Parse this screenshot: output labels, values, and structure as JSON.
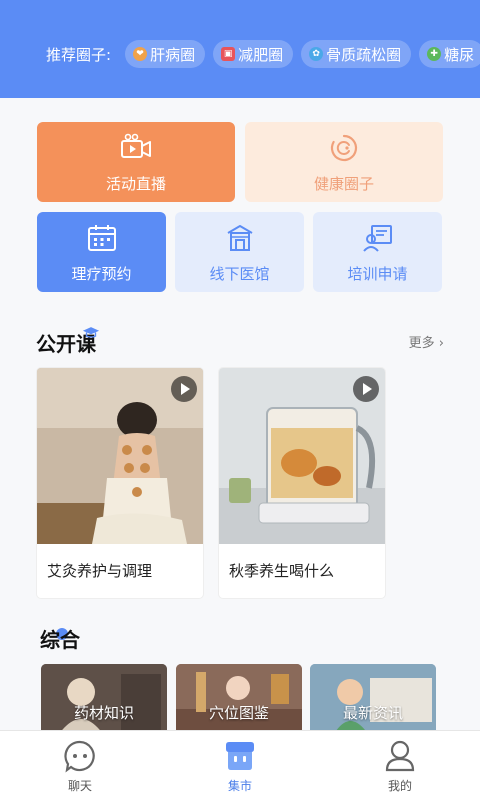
{
  "header": {
    "recommend_label": "推荐圈子:",
    "circles": [
      {
        "label": "肝病圈",
        "icon": "liver-icon",
        "color": "#f0a24a"
      },
      {
        "label": "减肥圈",
        "icon": "scale-icon",
        "color": "#e8545a"
      },
      {
        "label": "骨质疏松圈",
        "icon": "bone-icon",
        "color": "#4aa8e8"
      },
      {
        "label": "糖尿",
        "icon": "sugar-icon",
        "color": "#5cb85c"
      }
    ]
  },
  "quick_actions": {
    "live": "活动直播",
    "health_circle": "健康圈子",
    "therapy_booking": "理疗预约",
    "offline_clinic": "线下医馆",
    "training_apply": "培训申请"
  },
  "open_class": {
    "title": "公开课",
    "more": "更多",
    "courses": [
      {
        "title": "艾灸养护与调理",
        "image": "moxibustion-photo"
      },
      {
        "title": "秋季养生喝什么",
        "image": "tea-kettle-photo"
      }
    ]
  },
  "general": {
    "title": "综合",
    "categories": [
      {
        "label": "药材知识"
      },
      {
        "label": "穴位图鉴"
      },
      {
        "label": "最新资讯"
      }
    ]
  },
  "tabbar": {
    "items": [
      {
        "label": "聊天",
        "icon": "chat-icon"
      },
      {
        "label": "集市",
        "icon": "market-icon"
      },
      {
        "label": "我的",
        "icon": "profile-icon"
      }
    ],
    "active": "集市"
  },
  "colors": {
    "brand_blue": "#5b8cf5",
    "live_orange": "#f4915a",
    "therapy_blue": "#5b8cf5"
  }
}
